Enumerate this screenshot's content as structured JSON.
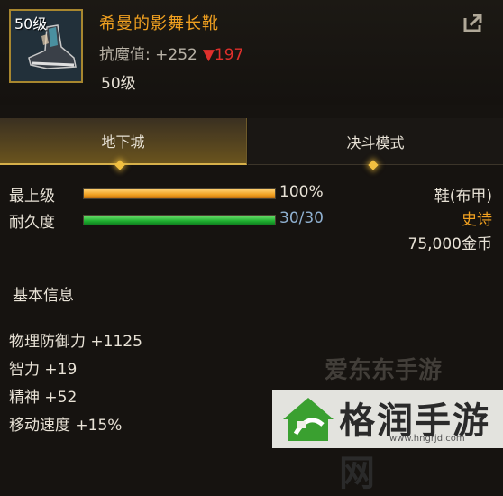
{
  "item": {
    "level_badge": "50级",
    "name": "希曼的影舞长靴",
    "stat_label": "抗魔值: +252",
    "stat_diff": "▼197",
    "required_level": "50级"
  },
  "tabs": [
    {
      "label": "地下城",
      "active": true
    },
    {
      "label": "决斗模式",
      "active": false
    }
  ],
  "bars": [
    {
      "label": "最上级",
      "value_text": "100%",
      "fraction": 1.0,
      "color": "#f0a020",
      "value_color": "#e8e2d6"
    },
    {
      "label": "耐久度",
      "value_text": "30/30",
      "fraction": 1.0,
      "color": "#20b030",
      "value_color": "#8fb0d0"
    }
  ],
  "info": {
    "type": "鞋(布甲)",
    "rarity": "史诗",
    "rarity_color": "#f0a020",
    "price": "75,000金币"
  },
  "section": {
    "title": "基本信息",
    "attributes": [
      "物理防御力 +1125",
      "智力 +19",
      "精神 +52",
      "移动速度 +15%"
    ]
  },
  "watermark": {
    "faint_text": "爱东东手游",
    "title": "格润手游网",
    "url": "www.hngrjd.com"
  }
}
